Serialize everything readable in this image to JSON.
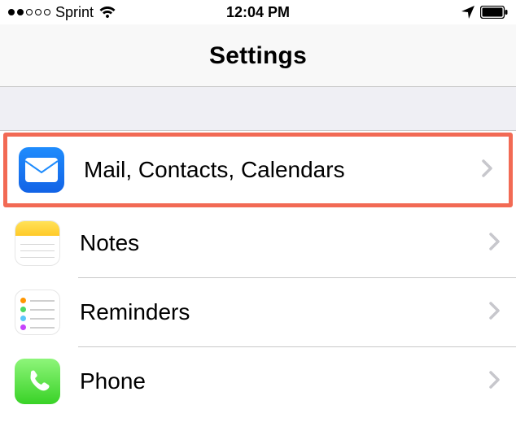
{
  "statusbar": {
    "signal_dots_filled": 2,
    "signal_dots_total": 5,
    "carrier": "Sprint",
    "time": "12:04 PM"
  },
  "header": {
    "title": "Settings"
  },
  "items": [
    {
      "label": "Mail, Contacts, Calendars",
      "icon": "mail",
      "highlighted": true
    },
    {
      "label": "Notes",
      "icon": "notes",
      "highlighted": false
    },
    {
      "label": "Reminders",
      "icon": "reminders",
      "highlighted": false
    },
    {
      "label": "Phone",
      "icon": "phone",
      "highlighted": false
    }
  ]
}
